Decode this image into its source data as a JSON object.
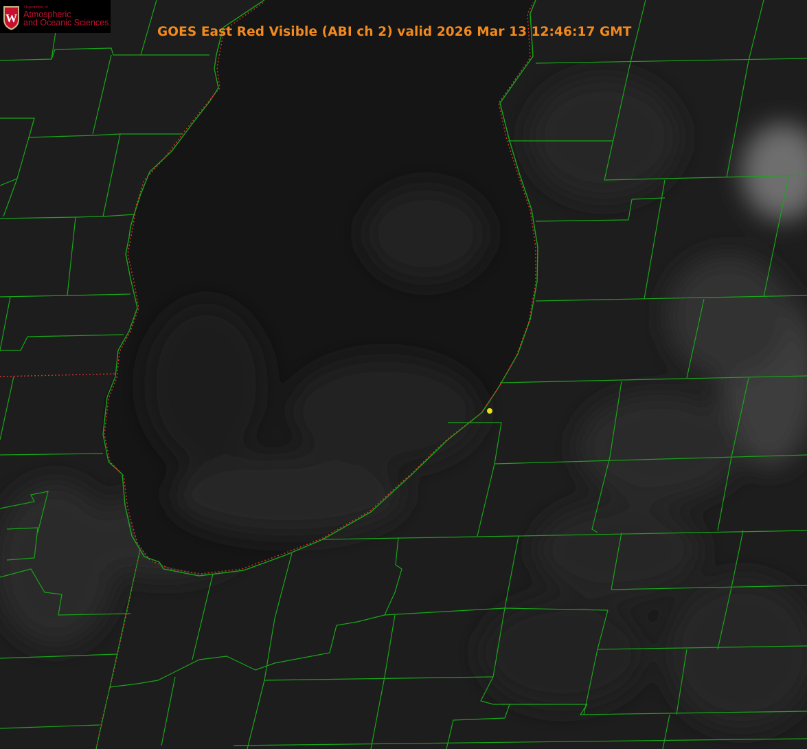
{
  "title": "GOES East Red Visible (ABI ch 2) valid 2026 Mar 13 12:46:17 GMT",
  "logo": {
    "department_label": "Department of",
    "line1": "Atmospheric",
    "line2": "and Oceanic Sciences",
    "shield_letter": "W",
    "shield_icon": "uw-shield-icon"
  },
  "colors": {
    "title": "#f28a1f",
    "county_borders": "#19a619",
    "state_border": "#d8342b",
    "marker": "#e6e21a",
    "background": "#1b1b1b",
    "lake": "#141414"
  },
  "map": {
    "product": "visible satellite imagery",
    "feature": "Lake Michigan (southern portion) with county boundaries",
    "marker_icon": "location-dot-icon"
  }
}
